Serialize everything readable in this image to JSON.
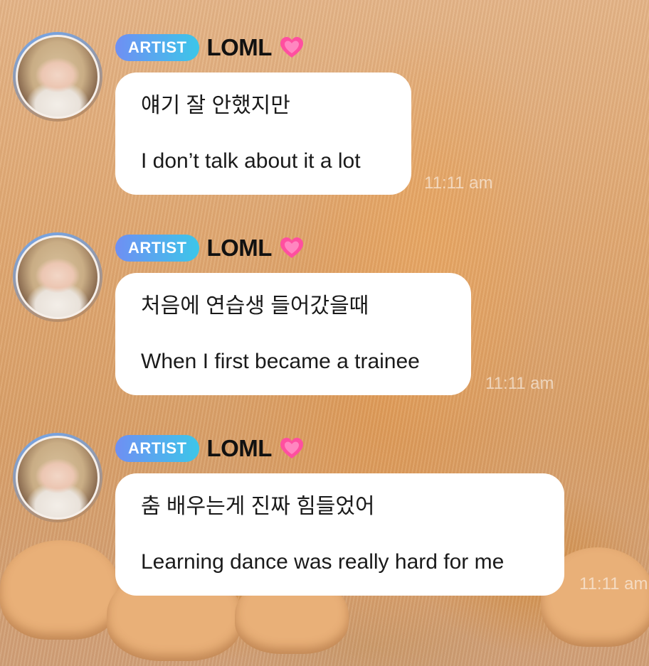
{
  "messages": [
    {
      "badge": "ARTIST",
      "name": "LOML",
      "heart_icon": "growing-heart-emoji",
      "korean": "얘기 잘 안했지만",
      "english": "I don’t talk about it a lot",
      "time": "11:11 am"
    },
    {
      "badge": "ARTIST",
      "name": "LOML",
      "heart_icon": "growing-heart-emoji",
      "korean": "처음에 연습생 들어갔을때",
      "english": "When I first became a trainee",
      "time": "11:11 am"
    },
    {
      "badge": "ARTIST",
      "name": "LOML",
      "heart_icon": "growing-heart-emoji",
      "korean": "춤 배우는게 진짜 힘들었어",
      "english": "Learning dance was really hard for me",
      "time": "11:11 am"
    }
  ],
  "colors": {
    "badge_gradient_start": "#6f8ff3",
    "badge_gradient_end": "#3cc6e9",
    "heart": "#ff4fa0",
    "bubble": "#ffffff",
    "background": "#dfa873"
  }
}
